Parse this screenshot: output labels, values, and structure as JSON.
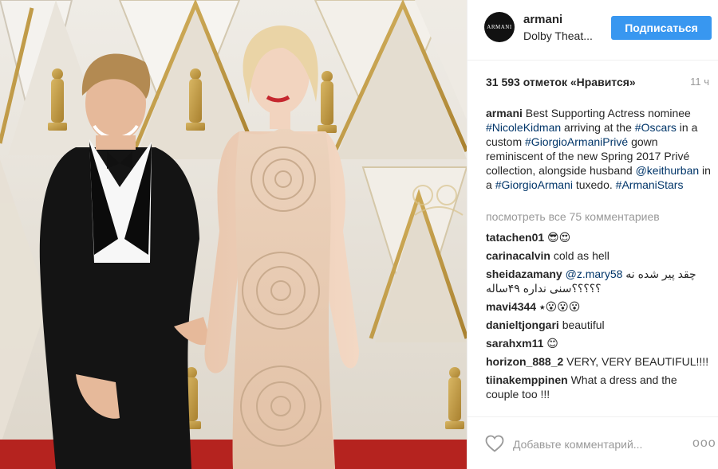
{
  "post": {
    "header": {
      "avatar_text": "ARMANI",
      "username": "armani",
      "location": "Dolby Theat...",
      "follow_label": "Подписаться"
    },
    "likes": "31 593 отметок «Нравится»",
    "time": "11 ч",
    "caption": {
      "username": "armani",
      "t1": " Best Supporting Actress nominee ",
      "tag1": "#NicoleKidman",
      "t2": " arriving at the ",
      "tag2": "#Oscars",
      "t3": " in a custom ",
      "tag3": "#GiorgioArmaniPrivé",
      "t4": " gown reminiscent of the new Spring 2017 Privé collection, alongside husband ",
      "tag4": "@keithurban",
      "t5": " in a ",
      "tag5": "#GiorgioArmani",
      "t6": " tuxedo. ",
      "tag6": "#ArmaniStars"
    },
    "view_all": "посмотреть все 75 комментариев",
    "comments": [
      {
        "user": "tatachen01",
        "text": "😎😍"
      },
      {
        "user": "carinacalvin",
        "text": "cold as hell"
      },
      {
        "user": "sheidazamany",
        "mention": "@z.mary58",
        "text": "چقد پیر شده نه ؟؟؟؟؟سنی نداره ۴۹ساله"
      },
      {
        "user": "mavi4344",
        "text": "⭑😮😮😮"
      },
      {
        "user": "danieltjongari",
        "text": "beautiful"
      },
      {
        "user": "sarahxm11",
        "text": "😊"
      },
      {
        "user": "horizon_888_2",
        "text": "VERY, VERY BEAUTIFUL!!!!"
      },
      {
        "user": "tiinakemppinen",
        "text": "What a dress and the couple too !!!"
      }
    ],
    "footer": {
      "add_comment_placeholder": "Добавьте комментарий...",
      "more": "ooo"
    }
  },
  "colors": {
    "accent": "#3897f0",
    "hashtag": "#003569",
    "muted": "#999999",
    "text": "#262626"
  },
  "icons": {
    "like": "heart-outline-icon",
    "options": "more-options-icon"
  }
}
